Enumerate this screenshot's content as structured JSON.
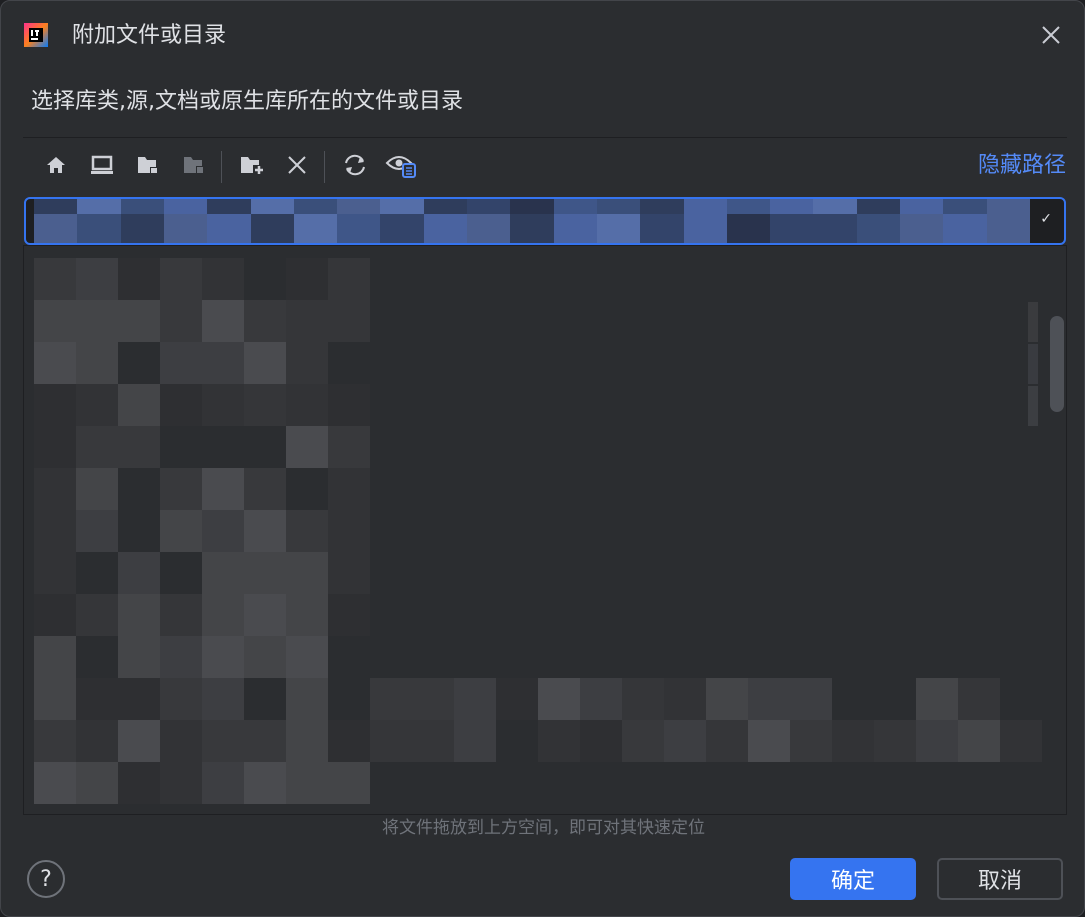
{
  "window": {
    "title": "附加文件或目录",
    "app_icon": "intellij-idea-icon",
    "close_icon": "close-icon"
  },
  "dialog": {
    "subtitle": "选择库类,源,文档或原生库所在的文件或目录",
    "hide_path_label": "隐藏路径",
    "path_value_state": "obscured",
    "drop_hint": "将文件拖放到上方空间，即可对其快速定位"
  },
  "toolbar": {
    "buttons": [
      {
        "name": "home-icon"
      },
      {
        "name": "desktop-icon"
      },
      {
        "name": "project-folder-icon"
      },
      {
        "name": "module-folder-icon"
      },
      {
        "name": "new-folder-icon"
      },
      {
        "name": "delete-icon"
      },
      {
        "name": "refresh-icon"
      },
      {
        "name": "show-hidden-icon"
      }
    ]
  },
  "footer": {
    "help_label": "?",
    "ok_label": "确定",
    "cancel_label": "取消"
  },
  "colors": {
    "accent": "#3574f0",
    "link": "#548af7",
    "background": "#2b2d30",
    "text": "#dfe1e5"
  }
}
